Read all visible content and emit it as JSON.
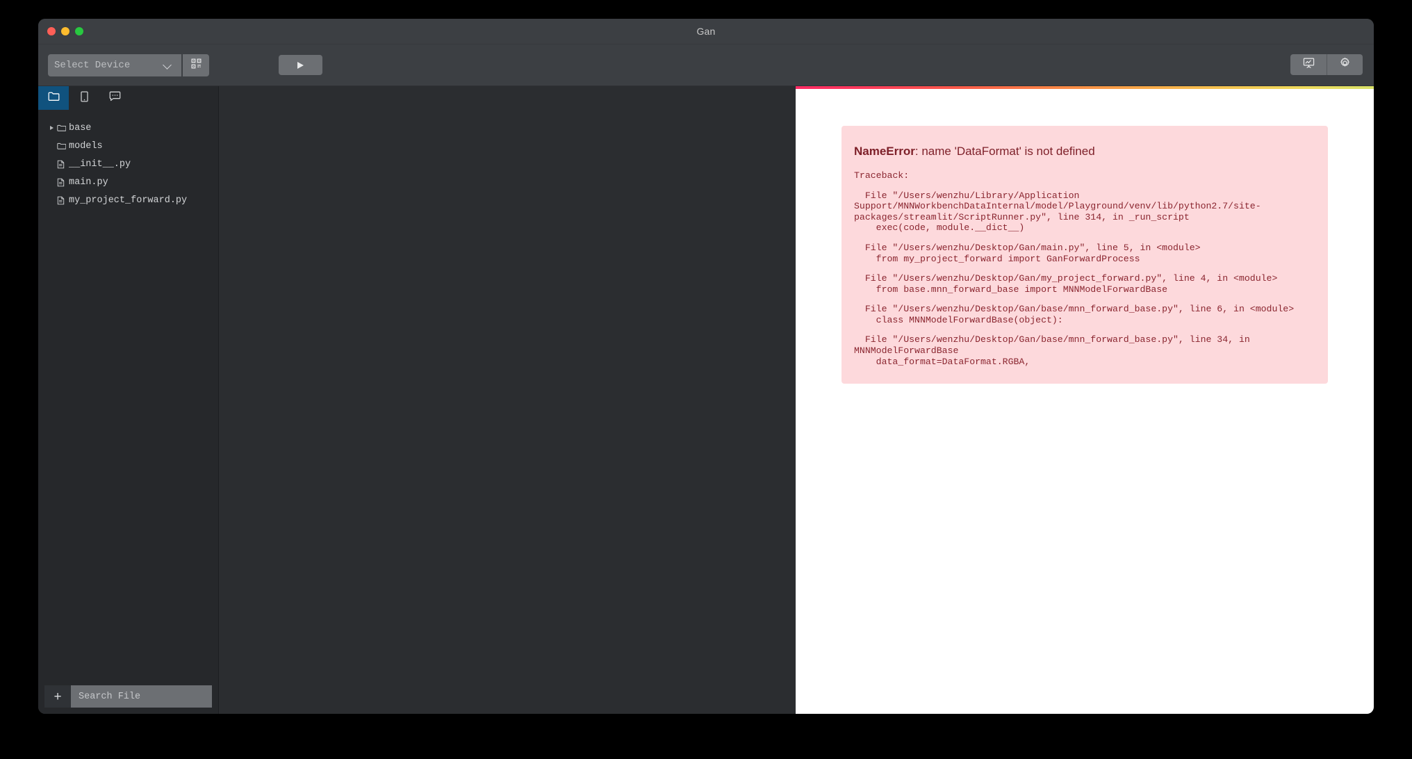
{
  "window": {
    "title": "Gan",
    "traffic_lights": [
      "close",
      "minimize",
      "zoom"
    ]
  },
  "toolbar": {
    "device_select_value": "Select Device",
    "device_select_options": [
      "Select Device"
    ],
    "qr_button_icon": "qr-code-icon",
    "run_button_icon": "play-icon",
    "right_buttons": [
      {
        "name": "presentation-board-button",
        "icon": "presentation-chart-icon"
      },
      {
        "name": "settings-button",
        "icon": "gear-icon"
      }
    ]
  },
  "sidebar": {
    "tabs": [
      {
        "name": "files-tab",
        "icon": "folder-icon",
        "active": true
      },
      {
        "name": "devices-tab",
        "icon": "mobile-device-icon",
        "active": false
      },
      {
        "name": "messages-tab",
        "icon": "chat-bubble-icon",
        "active": false
      }
    ],
    "tree": [
      {
        "label": "base",
        "type": "folder",
        "icon": "folder-icon",
        "expandable": true,
        "expanded": false
      },
      {
        "label": "models",
        "type": "folder",
        "icon": "folder-icon",
        "expandable": false,
        "expanded": false
      },
      {
        "label": "__init__.py",
        "type": "file",
        "icon": "file-icon",
        "expandable": false
      },
      {
        "label": "main.py",
        "type": "file",
        "icon": "file-icon",
        "expandable": false
      },
      {
        "label": "my_project_forward.py",
        "type": "file",
        "icon": "file-icon",
        "expandable": false
      }
    ],
    "add_button_label": "+",
    "search_placeholder": "Search File",
    "search_value": ""
  },
  "preview": {
    "loading_bar_colors": [
      "#ff2b64",
      "#f98646",
      "#f5c451",
      "#d9e268"
    ],
    "error": {
      "type": "NameError",
      "separator": ": ",
      "message": "name 'DataFormat' is not defined",
      "traceback_label": "Traceback:",
      "frames": [
        "  File \"/Users/wenzhu/Library/Application Support/MNNWorkbenchDataInternal/model/Playground/venv/lib/python2.7/site-packages/streamlit/ScriptRunner.py\", line 314, in _run_script\n    exec(code, module.__dict__)",
        "  File \"/Users/wenzhu/Desktop/Gan/main.py\", line 5, in <module>\n    from my_project_forward import GanForwardProcess",
        "  File \"/Users/wenzhu/Desktop/Gan/my_project_forward.py\", line 4, in <module>\n    from base.mnn_forward_base import MNNModelForwardBase",
        "  File \"/Users/wenzhu/Desktop/Gan/base/mnn_forward_base.py\", line 6, in <module>\n    class MNNModelForwardBase(object):",
        "  File \"/Users/wenzhu/Desktop/Gan/base/mnn_forward_base.py\", line 34, in MNNModelForwardBase\n    data_format=DataFormat.RGBA,"
      ]
    }
  }
}
